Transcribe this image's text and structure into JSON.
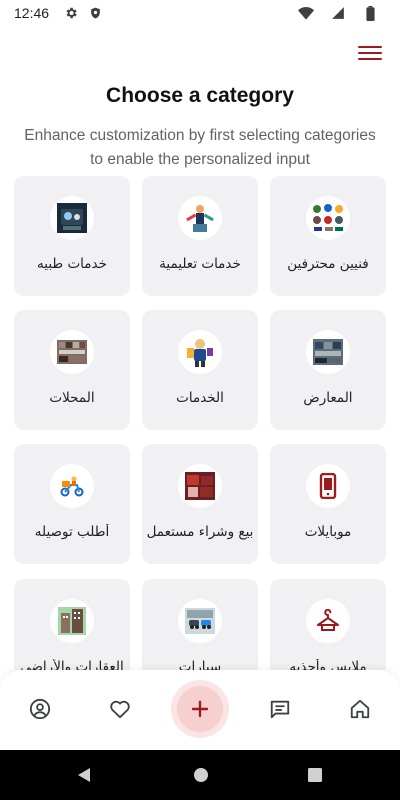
{
  "status_bar": {
    "time": "12:46"
  },
  "header": {
    "title": "Choose a category",
    "subtitle": "Enhance customization by first selecting categories to enable the personalized input"
  },
  "categories": [
    {
      "label": "فنيين محترفين",
      "icon": "technicians-photo"
    },
    {
      "label": "خدمات تعليمية",
      "icon": "education-photo"
    },
    {
      "label": "خدمات طبيه",
      "icon": "medical-photo"
    },
    {
      "label": "المعارض",
      "icon": "showrooms-photo"
    },
    {
      "label": "الخدمات",
      "icon": "services-photo"
    },
    {
      "label": "المحلات",
      "icon": "shops-photo"
    },
    {
      "label": "موبايلات",
      "icon": "mobile-phone-icon"
    },
    {
      "label": "بيع وشراء مستعمل",
      "icon": "buy-sell-used-photo"
    },
    {
      "label": "أطلب توصيله",
      "icon": "delivery-photo"
    },
    {
      "label": "ملابس وأحذيه",
      "icon": "hanger-icon"
    },
    {
      "label": "سيارات",
      "icon": "cars-photo"
    },
    {
      "label": "العقارات والأراضي",
      "icon": "real-estate-photo"
    }
  ],
  "bottom_nav": {
    "items": [
      "home-icon",
      "chat-icon",
      "add-icon",
      "heart-icon",
      "profile-icon"
    ]
  },
  "colors": {
    "accent": "#9b1c1c",
    "card_bg": "#f1f1f3",
    "fab_bg": "#f6cfcf"
  }
}
